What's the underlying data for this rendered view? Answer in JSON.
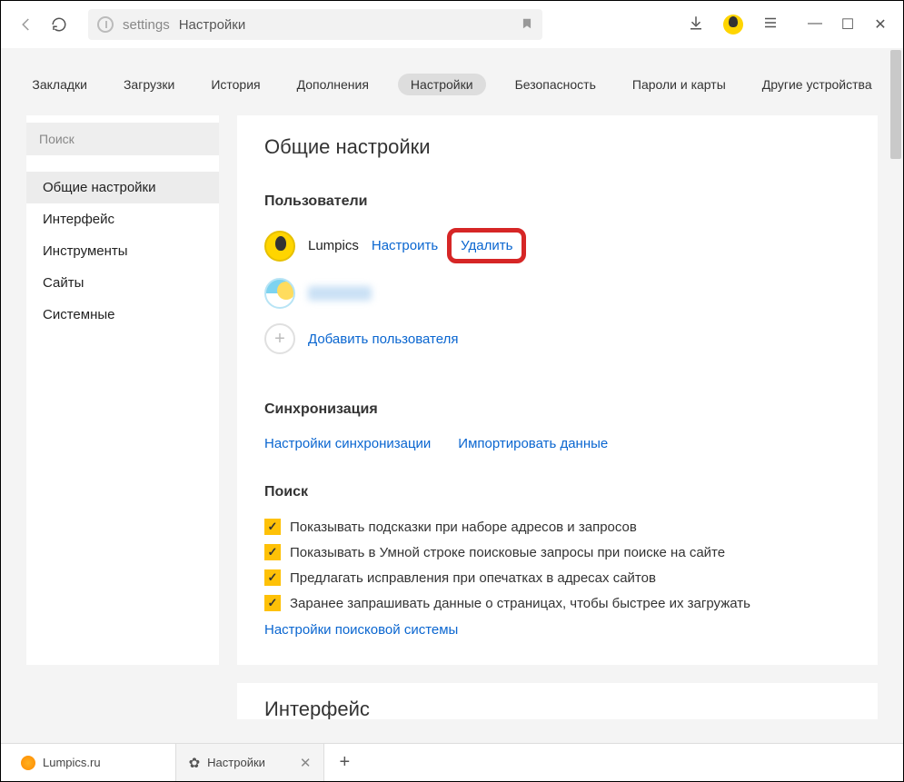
{
  "toolbar": {
    "address_proto": "settings",
    "address_title": "Настройки"
  },
  "topnav": {
    "items": [
      "Закладки",
      "Загрузки",
      "История",
      "Дополнения",
      "Настройки",
      "Безопасность",
      "Пароли и карты",
      "Другие устройства"
    ]
  },
  "sidebar": {
    "search_placeholder": "Поиск",
    "items": [
      "Общие настройки",
      "Интерфейс",
      "Инструменты",
      "Сайты",
      "Системные"
    ]
  },
  "main": {
    "title": "Общие настройки",
    "users_header": "Пользователи",
    "user1": {
      "name": "Lumpics",
      "configure": "Настроить",
      "delete": "Удалить"
    },
    "add_user": "Добавить пользователя",
    "sync_header": "Синхронизация",
    "sync_settings": "Настройки синхронизации",
    "import_data": "Импортировать данные",
    "search_header": "Поиск",
    "search_checks": [
      "Показывать подсказки при наборе адресов и запросов",
      "Показывать в Умной строке поисковые запросы при поиске на сайте",
      "Предлагать исправления при опечатках в адресах сайтов",
      "Заранее запрашивать данные о страницах, чтобы быстрее их загружать"
    ],
    "search_engine_link": "Настройки поисковой системы",
    "next_panel_title": "Интерфейс"
  },
  "tabs": {
    "tab1": "Lumpics.ru",
    "tab2": "Настройки"
  }
}
